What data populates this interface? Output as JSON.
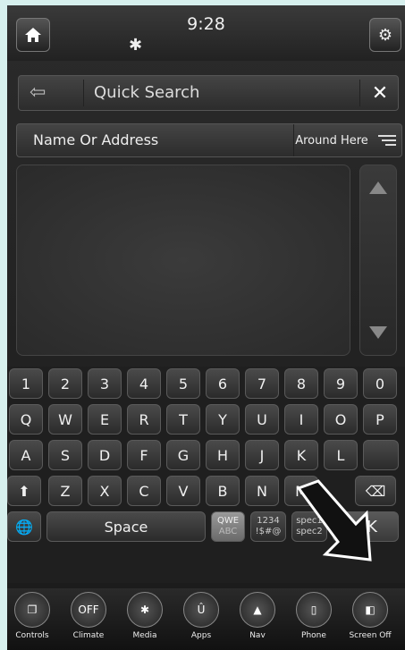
{
  "status": {
    "time": "9:28"
  },
  "search": {
    "title": "Quick Search"
  },
  "filter": {
    "name_label": "Name Or Address",
    "around_label": "Around Here"
  },
  "keyboard": {
    "row1": [
      "1",
      "2",
      "3",
      "4",
      "5",
      "6",
      "7",
      "8",
      "9",
      "0"
    ],
    "row2": [
      "Q",
      "W",
      "E",
      "R",
      "T",
      "Y",
      "U",
      "I",
      "O",
      "P"
    ],
    "row3": [
      "A",
      "S",
      "D",
      "F",
      "G",
      "H",
      "J",
      "K",
      "L"
    ],
    "row4": [
      "Z",
      "X",
      "C",
      "V",
      "B",
      "N",
      "M"
    ],
    "space": "Space",
    "mode_qwe": "QWE",
    "mode_abc": "ABC",
    "mode_num": "1234",
    "mode_sym": "!$#@",
    "mode_spec1": "spec1",
    "mode_spec2": "spec2",
    "ok": "OK"
  },
  "dock": [
    "Controls",
    "Climate",
    "Media",
    "Apps",
    "Nav",
    "Phone",
    "Screen Off"
  ],
  "climate_badge": "OFF"
}
